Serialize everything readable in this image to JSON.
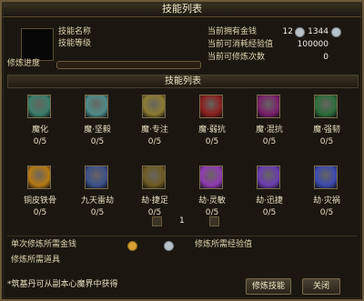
{
  "window": {
    "title": "技能列表"
  },
  "info": {
    "name_label": "技能名称",
    "level_label": "技能等级",
    "progress_label": "修炼进度",
    "progress_value": 0,
    "money_label": "当前拥有金钱",
    "money_value_left": "12",
    "money_value_right": "1344",
    "exp_label": "当前可消耗经验值",
    "exp_value": "100000",
    "count_label": "当前可修炼次数",
    "count_value": "0"
  },
  "section": {
    "title": "技能列表"
  },
  "skills": [
    {
      "name": "魔化",
      "count": "0/5",
      "icon": "magic-icon",
      "color": "#3b7e6b"
    },
    {
      "name": "魔·坚毅",
      "count": "0/5",
      "icon": "shield-icon",
      "color": "#4e8c8a"
    },
    {
      "name": "魔·专注",
      "count": "0/5",
      "icon": "focus-icon",
      "color": "#8a7a2f"
    },
    {
      "name": "魔·弱抗",
      "count": "0/5",
      "icon": "resist-icon",
      "color": "#8a1f1f"
    },
    {
      "name": "魔·混抗",
      "count": "0/5",
      "icon": "chaos-icon",
      "color": "#7a1f6c"
    },
    {
      "name": "魔·强韧",
      "count": "0/5",
      "icon": "tough-icon",
      "color": "#2c6c3b"
    },
    {
      "name": "铜皮铁骨",
      "count": "0/5",
      "icon": "armor-icon",
      "color": "#b77912"
    },
    {
      "name": "九天雷劫",
      "count": "0/5",
      "icon": "thunder-icon",
      "color": "#3b4f8a"
    },
    {
      "name": "劫·捷足",
      "count": "0/5",
      "icon": "speed-icon",
      "color": "#6d5b22"
    },
    {
      "name": "劫·灵敏",
      "count": "0/5",
      "icon": "agility-icon",
      "color": "#8f3bb1"
    },
    {
      "name": "劫·迅捷",
      "count": "0/5",
      "icon": "swift-icon",
      "color": "#6a3bb1"
    },
    {
      "name": "劫·灾祸",
      "count": "0/5",
      "icon": "disaster-icon",
      "color": "#3b4ab1"
    }
  ],
  "pager": {
    "page": "1"
  },
  "bottom": {
    "gold_label": "单次修炼所需金钱",
    "exp_label": "修炼所需经验值",
    "prop_label": "修炼所需道具",
    "note": "*筑基丹可从副本心魔界中获得",
    "practice_button": "修炼技能",
    "close_button": "关闭"
  }
}
